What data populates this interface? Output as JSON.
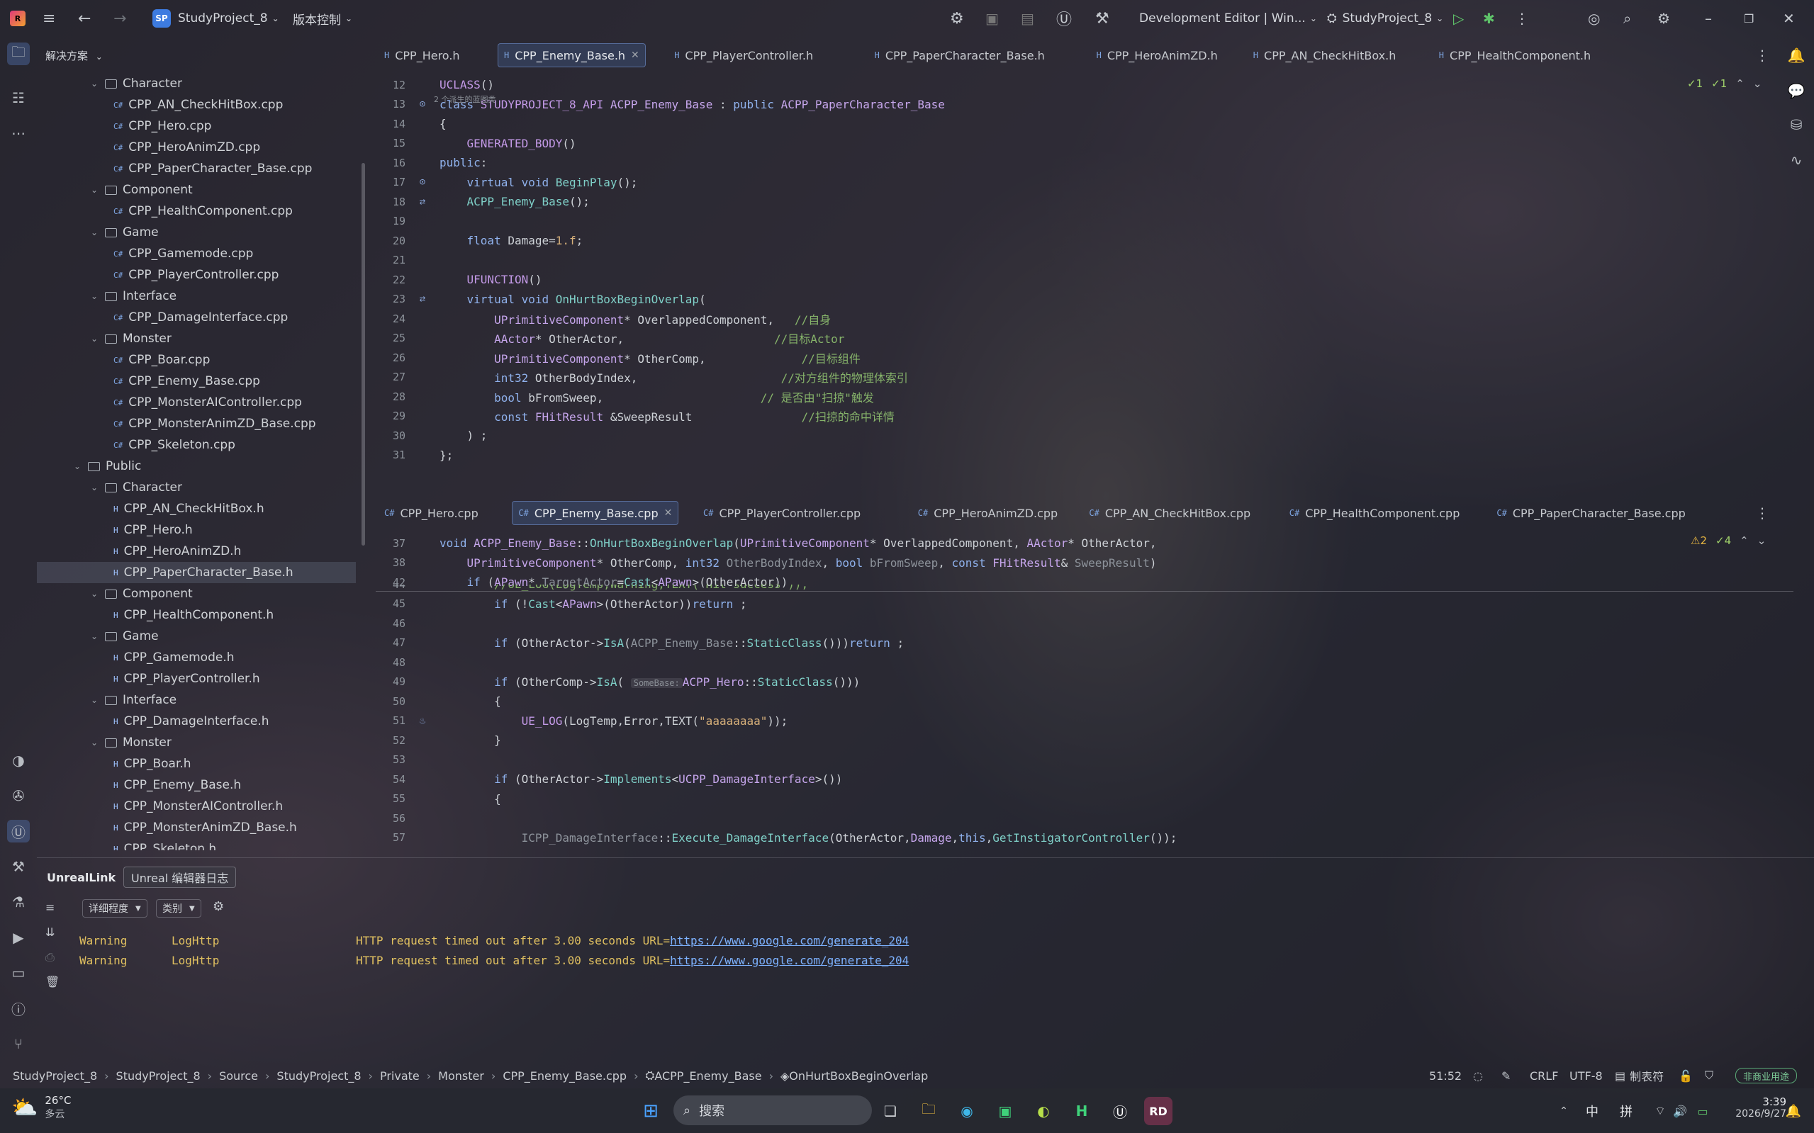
{
  "titlebar": {
    "project_name": "StudyProject_8",
    "project_badge": "SP",
    "vcs_menu": "版本控制",
    "run_config": "Development Editor | Win...",
    "solution_target": "StudyProject_8"
  },
  "explorer": {
    "header": "解决方案",
    "rows": [
      {
        "label": "Character",
        "type": "folder",
        "indent": 1
      },
      {
        "label": "CPP_AN_CheckHitBox.cpp",
        "type": "cpp",
        "indent": 2
      },
      {
        "label": "CPP_Hero.cpp",
        "type": "cpp",
        "indent": 2
      },
      {
        "label": "CPP_HeroAnimZD.cpp",
        "type": "cpp",
        "indent": 2
      },
      {
        "label": "CPP_PaperCharacter_Base.cpp",
        "type": "cpp",
        "indent": 2
      },
      {
        "label": "Component",
        "type": "folder",
        "indent": 1
      },
      {
        "label": "CPP_HealthComponent.cpp",
        "type": "cpp",
        "indent": 2
      },
      {
        "label": "Game",
        "type": "folder",
        "indent": 1
      },
      {
        "label": "CPP_Gamemode.cpp",
        "type": "cpp",
        "indent": 2
      },
      {
        "label": "CPP_PlayerController.cpp",
        "type": "cpp",
        "indent": 2
      },
      {
        "label": "Interface",
        "type": "folder",
        "indent": 1
      },
      {
        "label": "CPP_DamageInterface.cpp",
        "type": "cpp",
        "indent": 2
      },
      {
        "label": "Monster",
        "type": "folder",
        "indent": 1
      },
      {
        "label": "CPP_Boar.cpp",
        "type": "cpp",
        "indent": 2
      },
      {
        "label": "CPP_Enemy_Base.cpp",
        "type": "cpp",
        "indent": 2
      },
      {
        "label": "CPP_MonsterAIController.cpp",
        "type": "cpp",
        "indent": 2
      },
      {
        "label": "CPP_MonsterAnimZD_Base.cpp",
        "type": "cpp",
        "indent": 2
      },
      {
        "label": "CPP_Skeleton.cpp",
        "type": "cpp",
        "indent": 2
      },
      {
        "label": "Public",
        "type": "folder",
        "indent": 0
      },
      {
        "label": "Character",
        "type": "folder",
        "indent": 1
      },
      {
        "label": "CPP_AN_CheckHitBox.h",
        "type": "h",
        "indent": 2
      },
      {
        "label": "CPP_Hero.h",
        "type": "h",
        "indent": 2
      },
      {
        "label": "CPP_HeroAnimZD.h",
        "type": "h",
        "indent": 2
      },
      {
        "label": "CPP_PaperCharacter_Base.h",
        "type": "h",
        "indent": 2,
        "selected": true
      },
      {
        "label": "Component",
        "type": "folder",
        "indent": 1
      },
      {
        "label": "CPP_HealthComponent.h",
        "type": "h",
        "indent": 2
      },
      {
        "label": "Game",
        "type": "folder",
        "indent": 1
      },
      {
        "label": "CPP_Gamemode.h",
        "type": "h",
        "indent": 2
      },
      {
        "label": "CPP_PlayerController.h",
        "type": "h",
        "indent": 2
      },
      {
        "label": "Interface",
        "type": "folder",
        "indent": 1
      },
      {
        "label": "CPP_DamageInterface.h",
        "type": "h",
        "indent": 2
      },
      {
        "label": "Monster",
        "type": "folder",
        "indent": 1
      },
      {
        "label": "CPP_Boar.h",
        "type": "h",
        "indent": 2
      },
      {
        "label": "CPP_Enemy_Base.h",
        "type": "h",
        "indent": 2
      },
      {
        "label": "CPP_MonsterAIController.h",
        "type": "h",
        "indent": 2
      },
      {
        "label": "CPP_MonsterAnimZD_Base.h",
        "type": "h",
        "indent": 2
      },
      {
        "label": "CPP_Skeleton.h",
        "type": "h",
        "indent": 2
      }
    ]
  },
  "top_editor": {
    "tabs": [
      "CPP_Hero.h",
      "CPP_Enemy_Base.h",
      "CPP_PlayerController.h",
      "CPP_PaperCharacter_Base.h",
      "CPP_HeroAnimZD.h",
      "CPP_AN_CheckHitBox.h",
      "CPP_HealthComponent.h"
    ],
    "active_tab": 1,
    "inspections": {
      "ok1": "✓1",
      "ok2": "✓1"
    },
    "usage_hint": "2 个派生的蓝图类",
    "lines": [
      {
        "n": "12",
        "tokens": [
          [
            "mac",
            "UCLASS"
          ],
          [
            "txt",
            "()"
          ]
        ]
      },
      {
        "n": "13",
        "gutter": "⊙",
        "tokens": [
          [
            "kw",
            "class "
          ],
          [
            "mac",
            "STUDYPROJECT_8_API "
          ],
          [
            "ty",
            "ACPP_Enemy_Base"
          ],
          [
            "txt",
            " : "
          ],
          [
            "kw",
            "public "
          ],
          [
            "ty",
            "ACPP_PaperCharacter_Base"
          ]
        ]
      },
      {
        "n": "14",
        "tokens": [
          [
            "txt",
            "{"
          ]
        ]
      },
      {
        "n": "15",
        "tokens": [
          [
            "txt",
            "    "
          ],
          [
            "mac",
            "GENERATED_BODY"
          ],
          [
            "txt",
            "()"
          ]
        ]
      },
      {
        "n": "16",
        "tokens": [
          [
            "kw",
            "public"
          ],
          [
            "txt",
            ":"
          ]
        ]
      },
      {
        "n": "17",
        "gutter": "⊙",
        "tokens": [
          [
            "txt",
            "    "
          ],
          [
            "kw",
            "virtual void "
          ],
          [
            "fn",
            "BeginPlay"
          ],
          [
            "txt",
            "();"
          ]
        ]
      },
      {
        "n": "18",
        "gutter": "⇄",
        "tokens": [
          [
            "txt",
            "    "
          ],
          [
            "fn",
            "ACPP_Enemy_Base"
          ],
          [
            "txt",
            "();"
          ]
        ]
      },
      {
        "n": "19",
        "tokens": []
      },
      {
        "n": "20",
        "tokens": [
          [
            "txt",
            "    "
          ],
          [
            "kw",
            "float "
          ],
          [
            "txt",
            "Damage="
          ],
          [
            "num",
            "1.f"
          ],
          [
            "txt",
            ";"
          ]
        ]
      },
      {
        "n": "21",
        "tokens": []
      },
      {
        "n": "22",
        "tokens": [
          [
            "txt",
            "    "
          ],
          [
            "mac",
            "UFUNCTION"
          ],
          [
            "txt",
            "()"
          ]
        ]
      },
      {
        "n": "23",
        "gutter": "⇄",
        "tokens": [
          [
            "txt",
            "    "
          ],
          [
            "kw",
            "virtual void "
          ],
          [
            "fn",
            "OnHurtBoxBeginOverlap"
          ],
          [
            "txt",
            "("
          ]
        ]
      },
      {
        "n": "24",
        "tokens": [
          [
            "txt",
            "        "
          ],
          [
            "ty",
            "UPrimitiveComponent"
          ],
          [
            "txt",
            "* OverlappedComponent,   "
          ],
          [
            "cm",
            "//自身"
          ]
        ]
      },
      {
        "n": "25",
        "tokens": [
          [
            "txt",
            "        "
          ],
          [
            "ty",
            "AActor"
          ],
          [
            "txt",
            "* OtherActor,                      "
          ],
          [
            "cm",
            "//目标Actor"
          ]
        ]
      },
      {
        "n": "26",
        "tokens": [
          [
            "txt",
            "        "
          ],
          [
            "ty",
            "UPrimitiveComponent"
          ],
          [
            "txt",
            "* OtherComp,              "
          ],
          [
            "cm",
            "//目标组件"
          ]
        ]
      },
      {
        "n": "27",
        "tokens": [
          [
            "txt",
            "        "
          ],
          [
            "kw",
            "int32 "
          ],
          [
            "txt",
            "OtherBodyIndex,                     "
          ],
          [
            "cm",
            "//对方组件的物理体索引"
          ]
        ]
      },
      {
        "n": "28",
        "tokens": [
          [
            "txt",
            "        "
          ],
          [
            "kw",
            "bool "
          ],
          [
            "txt",
            "bFromSweep,                       "
          ],
          [
            "cm",
            "// 是否由\"扫掠\"触发"
          ]
        ]
      },
      {
        "n": "29",
        "tokens": [
          [
            "txt",
            "        "
          ],
          [
            "kw",
            "const "
          ],
          [
            "ty",
            "FHitResult "
          ],
          [
            "txt",
            "&SweepResult                "
          ],
          [
            "cm",
            "//扫掠的命中详情"
          ]
        ]
      },
      {
        "n": "30",
        "tokens": [
          [
            "txt",
            "    ) ;"
          ]
        ]
      },
      {
        "n": "31",
        "tokens": [
          [
            "txt",
            "};"
          ]
        ]
      }
    ]
  },
  "bottom_editor": {
    "tabs": [
      "CPP_Hero.cpp",
      "CPP_Enemy_Base.cpp",
      "CPP_PlayerController.cpp",
      "CPP_HeroAnimZD.cpp",
      "CPP_AN_CheckHitBox.cpp",
      "CPP_HealthComponent.cpp",
      "CPP_PaperCharacter_Base.cpp"
    ],
    "active_tab": 1,
    "inspections": {
      "warn": "⚠2",
      "ok": "✓4"
    },
    "sticky": [
      {
        "n": "37",
        "tokens": [
          [
            "kw",
            "void "
          ],
          [
            "ty",
            "ACPP_Enemy_Base"
          ],
          [
            "txt",
            "::"
          ],
          [
            "fn",
            "OnHurtBoxBeginOverlap"
          ],
          [
            "txt",
            "("
          ],
          [
            "ty",
            "UPrimitiveComponent"
          ],
          [
            "txt",
            "* OverlappedComponent, "
          ],
          [
            "ty",
            "AActor"
          ],
          [
            "txt",
            "* OtherActor,"
          ]
        ]
      },
      {
        "n": "38",
        "tokens": [
          [
            "txt",
            "    "
          ],
          [
            "ty",
            "UPrimitiveComponent"
          ],
          [
            "txt",
            "* OtherComp, "
          ],
          [
            "kw",
            "int32 "
          ],
          [
            "dim",
            "OtherBodyIndex"
          ],
          [
            "txt",
            ", "
          ],
          [
            "kw",
            "bool "
          ],
          [
            "dim",
            "bFromSweep"
          ],
          [
            "txt",
            ", "
          ],
          [
            "kw",
            "const "
          ],
          [
            "ty",
            "FHitResult"
          ],
          [
            "txt",
            "& "
          ],
          [
            "dim",
            "SweepResult"
          ],
          [
            "txt",
            ")"
          ]
        ]
      },
      {
        "n": "42",
        "tokens": [
          [
            "txt",
            "    "
          ],
          [
            "kw",
            "if "
          ],
          [
            "txt",
            "("
          ],
          [
            "ty",
            "APawn"
          ],
          [
            "txt",
            "* "
          ],
          [
            "dim",
            "TargetActor"
          ],
          [
            "txt",
            "="
          ],
          [
            "fn",
            "Cast"
          ],
          [
            "txt",
            "<"
          ],
          [
            "ty",
            "APawn"
          ],
          [
            "txt",
            ">(OtherActor))"
          ]
        ]
      }
    ],
    "lines": [
      {
        "n": "44",
        "tokens": [
          [
            "txt",
            "        "
          ],
          [
            "cm",
            "//UE_LOG(LogTemp,Warning,TEXT(\"Hit success\"));"
          ]
        ]
      },
      {
        "n": "45",
        "tokens": [
          [
            "txt",
            "        "
          ],
          [
            "kw",
            "if "
          ],
          [
            "txt",
            "(!"
          ],
          [
            "fn",
            "Cast"
          ],
          [
            "txt",
            "<"
          ],
          [
            "ty",
            "APawn"
          ],
          [
            "txt",
            ">(OtherActor))"
          ],
          [
            "kw",
            "return "
          ],
          [
            "txt",
            ";"
          ]
        ]
      },
      {
        "n": "46",
        "tokens": []
      },
      {
        "n": "47",
        "tokens": [
          [
            "txt",
            "        "
          ],
          [
            "kw",
            "if "
          ],
          [
            "txt",
            "(OtherActor->"
          ],
          [
            "fn",
            "IsA"
          ],
          [
            "txt",
            "("
          ],
          [
            "dim",
            "ACPP_Enemy_Base"
          ],
          [
            "txt",
            "::"
          ],
          [
            "fn",
            "StaticClass"
          ],
          [
            "txt",
            "()))"
          ],
          [
            "kw",
            "return "
          ],
          [
            "txt",
            ";"
          ]
        ]
      },
      {
        "n": "48",
        "tokens": []
      },
      {
        "n": "49",
        "tokens": [
          [
            "txt",
            "        "
          ],
          [
            "kw",
            "if "
          ],
          [
            "txt",
            "(OtherComp->"
          ],
          [
            "fn",
            "IsA"
          ],
          [
            "txt",
            "( "
          ],
          [
            "hint",
            "SomeBase:"
          ],
          [
            "ty",
            "ACPP_Hero"
          ],
          [
            "txt",
            "::"
          ],
          [
            "fn",
            "StaticClass"
          ],
          [
            "txt",
            "()))"
          ]
        ]
      },
      {
        "n": "50",
        "tokens": [
          [
            "txt",
            "        {"
          ]
        ]
      },
      {
        "n": "51",
        "gutter": "♨",
        "tokens": [
          [
            "txt",
            "            "
          ],
          [
            "mac",
            "UE_LOG"
          ],
          [
            "txt",
            "(LogTemp,Error,TEXT("
          ],
          [
            "str",
            "\"aaaaaaaa\""
          ],
          [
            "txt",
            "));"
          ]
        ]
      },
      {
        "n": "52",
        "tokens": [
          [
            "txt",
            "        }"
          ]
        ]
      },
      {
        "n": "53",
        "tokens": []
      },
      {
        "n": "54",
        "tokens": [
          [
            "txt",
            "        "
          ],
          [
            "kw",
            "if "
          ],
          [
            "txt",
            "(OtherActor->"
          ],
          [
            "fn",
            "Implements"
          ],
          [
            "txt",
            "<"
          ],
          [
            "ty",
            "UCPP_DamageInterface"
          ],
          [
            "txt",
            ">())"
          ]
        ]
      },
      {
        "n": "55",
        "tokens": [
          [
            "txt",
            "        {"
          ]
        ]
      },
      {
        "n": "56",
        "tokens": []
      },
      {
        "n": "57",
        "tokens": [
          [
            "txt",
            "            "
          ],
          [
            "dim",
            "ICPP_DamageInterface"
          ],
          [
            "txt",
            "::"
          ],
          [
            "fn",
            "Execute_DamageInterface"
          ],
          [
            "txt",
            "(OtherActor,"
          ],
          [
            "ty",
            "Damage"
          ],
          [
            "txt",
            ","
          ],
          [
            "kw",
            "this"
          ],
          [
            "txt",
            ","
          ],
          [
            "fn",
            "GetInstigatorController"
          ],
          [
            "txt",
            "());"
          ]
        ]
      }
    ]
  },
  "panel": {
    "tab_unreallink": "UnrealLink",
    "tab_editor_log": "Unreal 编辑器日志",
    "filter_verbosity": "详细程度",
    "filter_category": "类别",
    "logs": [
      {
        "level": "Warning",
        "category": "LogHttp",
        "message": "HTTP request timed out after 3.00 seconds URL=",
        "url": "https://www.google.com/generate_204"
      },
      {
        "level": "Warning",
        "category": "LogHttp",
        "message": "HTTP request timed out after 3.00 seconds URL=",
        "url": "https://www.google.com/generate_204"
      }
    ]
  },
  "statusbar": {
    "breadcrumbs": [
      "StudyProject_8",
      "StudyProject_8",
      "Source",
      "StudyProject_8",
      "Private",
      "Monster",
      "CPP_Enemy_Base.cpp",
      "ACPP_Enemy_Base",
      "OnHurtBoxBeginOverlap"
    ],
    "position": "51:52",
    "line_ending": "CRLF",
    "encoding": "UTF-8",
    "indent": "制表符",
    "license": "非商业用途"
  },
  "taskbar": {
    "temperature": "26°C",
    "weather": "多云",
    "search_placeholder": "搜索",
    "ime1": "中",
    "ime2": "拼",
    "time": "3:39",
    "date": "2026/9/27"
  }
}
